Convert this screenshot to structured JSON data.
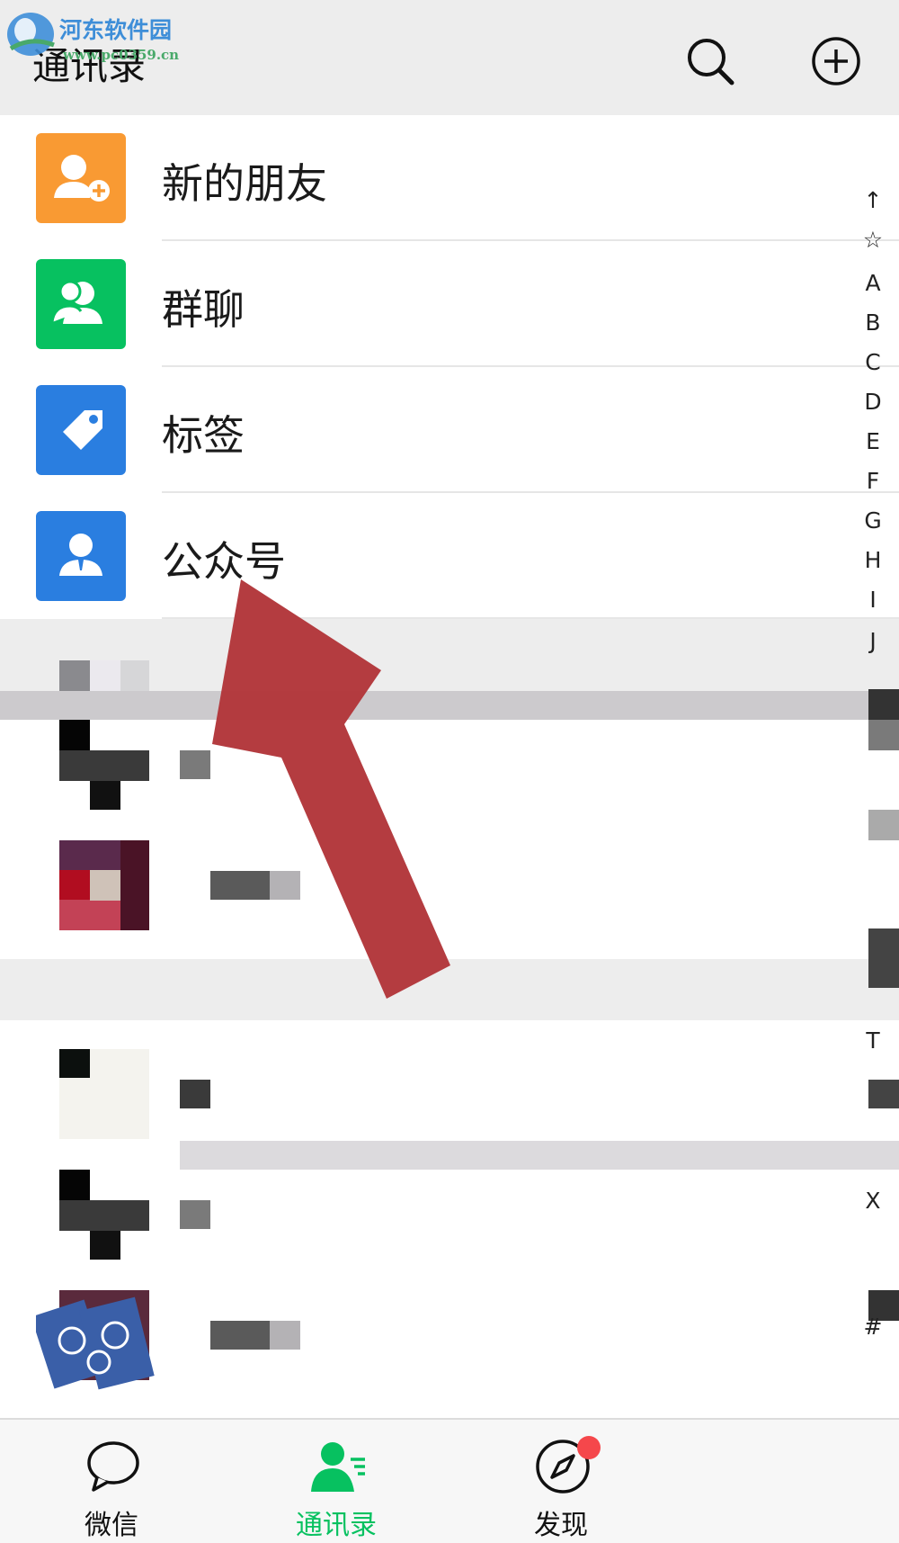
{
  "header": {
    "title": "通讯录"
  },
  "watermark": {
    "name": "河东软件园",
    "url": "www.pc0359.cn"
  },
  "menu": [
    {
      "label": "新的朋友",
      "icon": "add-friend-icon",
      "color": "#f99a33"
    },
    {
      "label": "群聊",
      "icon": "group-chat-icon",
      "color": "#07c160"
    },
    {
      "label": "标签",
      "icon": "tag-icon",
      "color": "#2a7ee0"
    },
    {
      "label": "公众号",
      "icon": "official-account-icon",
      "color": "#2a7ee0"
    }
  ],
  "index": [
    "↑",
    "☆",
    "A",
    "B",
    "C",
    "D",
    "E",
    "F",
    "G",
    "H",
    "I",
    "J",
    "T",
    "X",
    "#"
  ],
  "tabs": [
    {
      "label": "微信",
      "icon": "chat-bubble-icon",
      "active": false
    },
    {
      "label": "通讯录",
      "icon": "contacts-icon",
      "active": true
    },
    {
      "label": "发现",
      "icon": "compass-icon",
      "active": false,
      "badge": true
    }
  ],
  "colors": {
    "accent": "#07c160",
    "annotation_arrow": "#b2363a",
    "badge": "#f5474b"
  }
}
